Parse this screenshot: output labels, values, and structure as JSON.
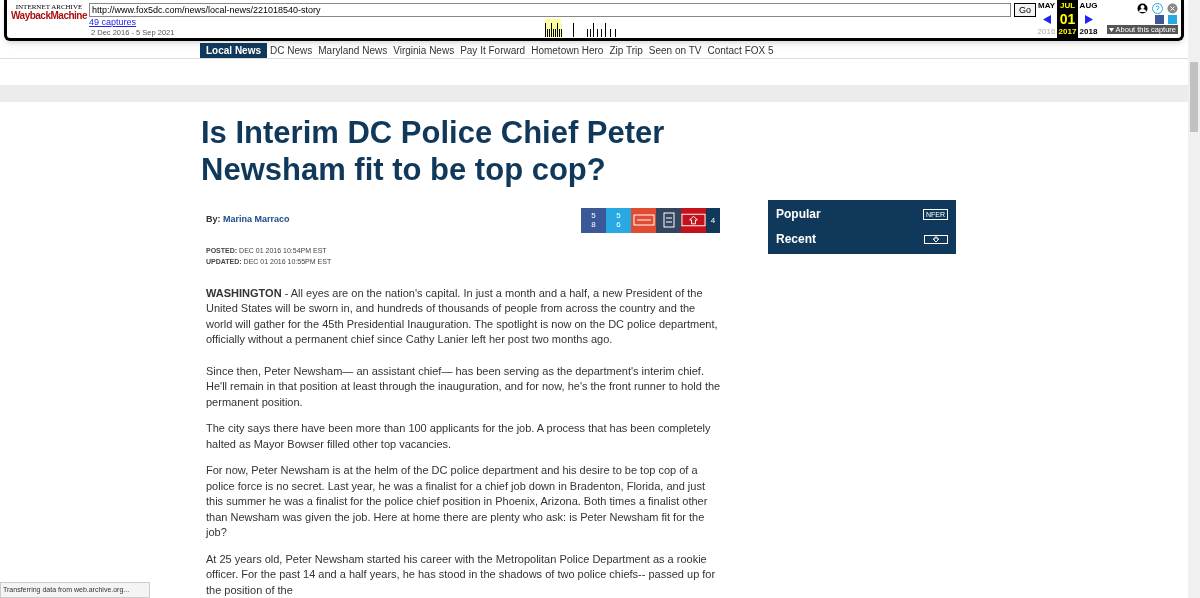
{
  "wayback": {
    "logo_top": "INTERNET ARCHIVE",
    "logo": "WaybackMachine",
    "url": "http://www.fox5dc.com/news/local-news/221018540-story",
    "go": "Go",
    "captures": "49 captures",
    "range": "2 Dec 2016 - 5 Sep 2021",
    "months": [
      {
        "label": "MAY",
        "year": "2016",
        "selected": false
      },
      {
        "label": "JUL",
        "day": "01",
        "year": "2017",
        "selected": true
      },
      {
        "label": "AUG",
        "year": "2018",
        "selected": false
      }
    ],
    "about": "About this capture"
  },
  "nav": {
    "section": "Local News",
    "items": [
      "DC News",
      "Maryland News",
      "Virginia News",
      "Pay It Forward",
      "Hometown Hero",
      "Zip Trip",
      "Seen on TV",
      "Contact FOX 5"
    ]
  },
  "article": {
    "title": "Is Interim DC Police Chief Peter Newsham fit to be top cop?",
    "by_label": "By:",
    "author": "Marina Marraco",
    "share": [
      {
        "kind": "facebook",
        "count": "58",
        "color": "#3b5998"
      },
      {
        "kind": "twitter",
        "count": "56",
        "color": "#29a9e1"
      },
      {
        "kind": "email",
        "color": "#e14b32"
      },
      {
        "kind": "print",
        "color": "#34465d"
      },
      {
        "kind": "share",
        "color": "#c4111b"
      },
      {
        "kind": "total",
        "count": "4",
        "color": "#10385a"
      }
    ],
    "posted_label": "POSTED:",
    "posted": "DEC 01 2016 10:54PM EST",
    "updated_label": "UPDATED:",
    "updated": "DEC 01 2016 10:55PM EST",
    "paragraphs": [
      "**WASHINGTON** - All eyes are on the nation's capital. In just a month and a half, a new President of the United States will be sworn in, and hundreds of thousands of people from across the country and the world will gather for the 45th Presidential Inauguration. The spotlight is now on the DC police department, officially without a permanent chief since Cathy Lanier left her post two months ago.",
      "Since then, Peter Newsham— an assistant chief— has been serving as the department's interim chief. He'll remain in that position at least through the inauguration, and for now, he's the front runner to hold the permanent position.",
      "The city says there have been more than 100 applicants for the job. A process that has been completely halted as Mayor Bowser filled other top vacancies.",
      "For now, Peter Newsham is at the helm of the DC police department and his desire to be top cop of a police force is no secret. Last year, he was a finalist for a chief job down in Bradenton, Florida, and just this summer he was a finalist for the police chief position in Phoenix, Arizona. Both times a finalist other than Newsham was given the job. Here at home there are plenty who ask:  is Peter Newsham fit for the job?",
      "At 25 years old, Peter Newsham started his career with the Metropolitan Police Department as a rookie officer. For the past 14 and a half years, he has stood in the shadows of two police chiefs-- passed up for the position of the"
    ]
  },
  "sidebar": {
    "tabs": [
      {
        "label": "Popular",
        "icon_text": "NFER"
      },
      {
        "label": "Recent"
      }
    ]
  },
  "status_bar": "Transferring data from web.archive.org..."
}
